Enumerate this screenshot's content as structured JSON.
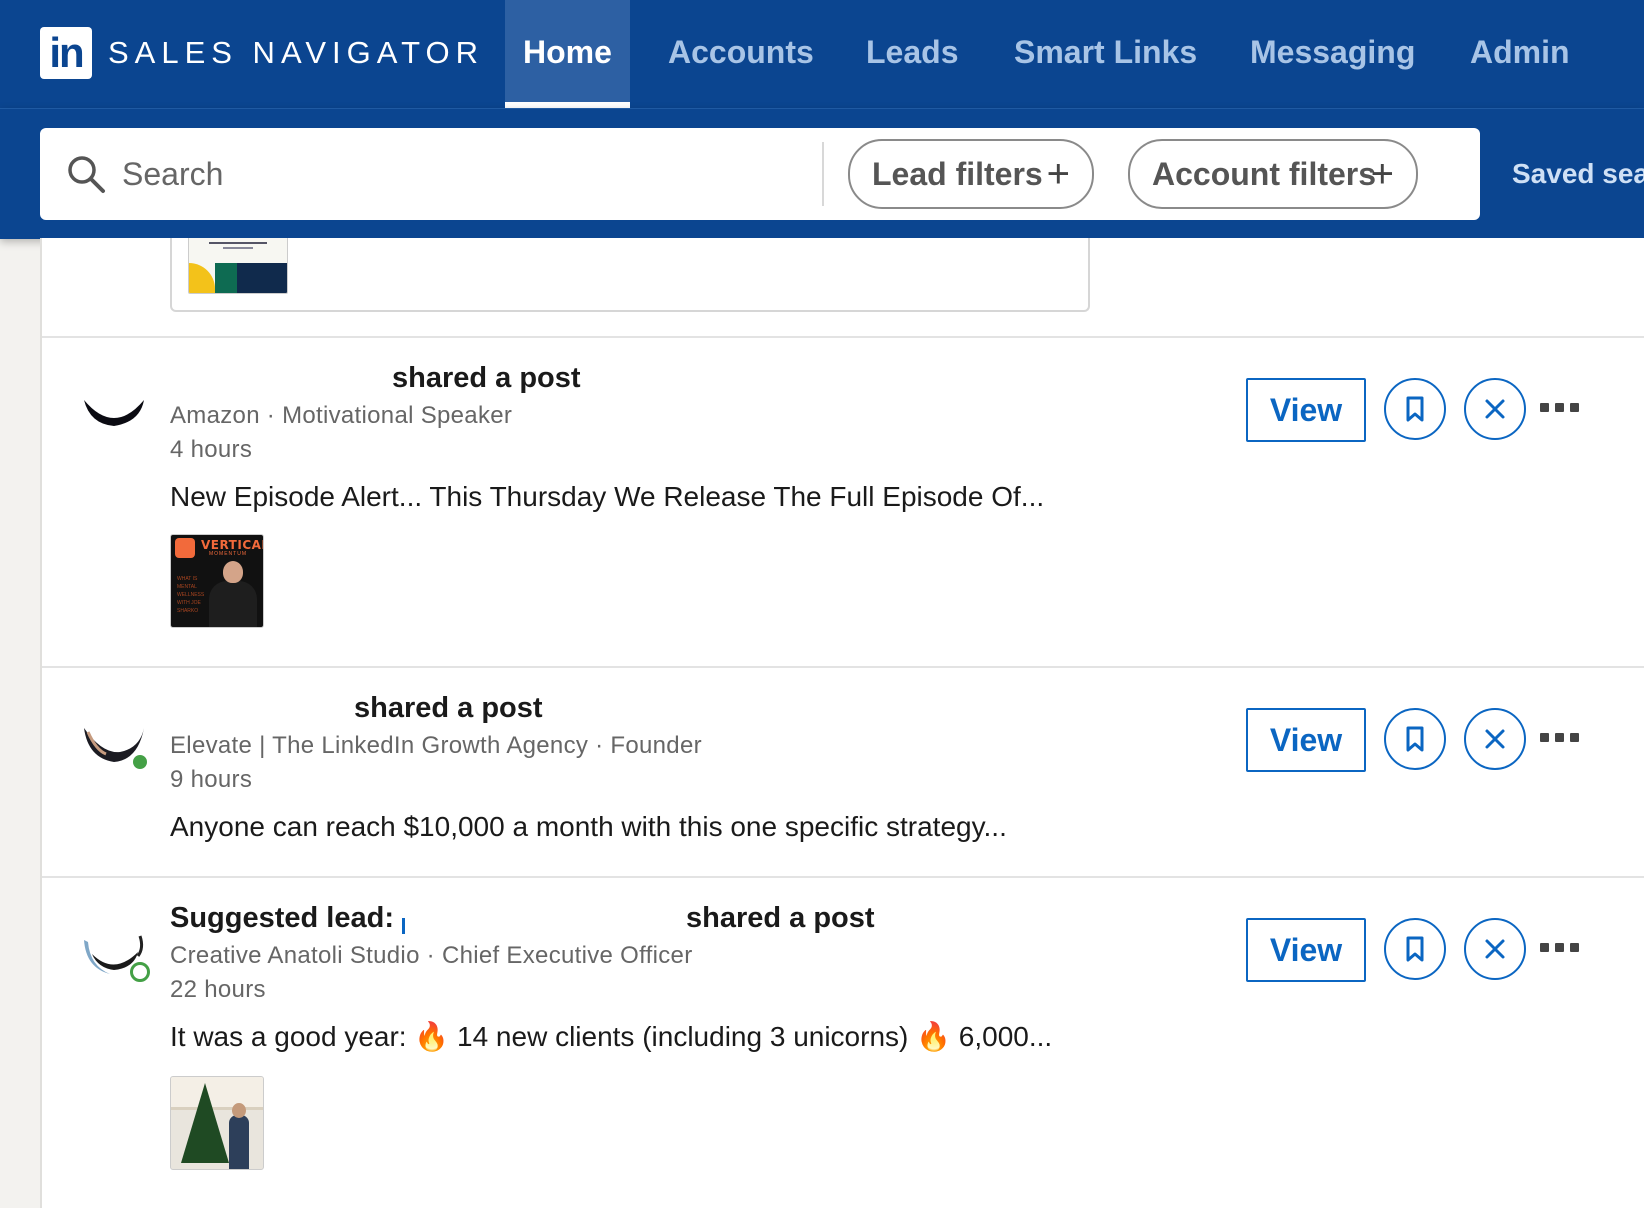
{
  "app": {
    "logo_text": "in",
    "brand": "SALES NAVIGATOR"
  },
  "nav": {
    "tabs": [
      {
        "label": "Home",
        "active": true
      },
      {
        "label": "Accounts",
        "active": false
      },
      {
        "label": "Leads",
        "active": false
      },
      {
        "label": "Smart Links",
        "active": false
      },
      {
        "label": "Messaging",
        "active": false
      },
      {
        "label": "Admin",
        "active": false
      }
    ]
  },
  "search": {
    "placeholder": "Search",
    "lead_filters_label": "Lead filters",
    "account_filters_label": "Account filters",
    "saved_searches_label": "Saved sea"
  },
  "feed": {
    "items": [
      {
        "headline": "shared a post",
        "company_role": "Amazon · Motivational Speaker",
        "time": "4 hours",
        "text": "New Episode Alert... This Thursday We Release The Full Episode Of...",
        "thumbnail": {
          "title": "VERTICAL",
          "subtitle": "MOMENTUM",
          "caption": "WHAT IS MENTAL WELLNESS WITH JOE SHARKO"
        },
        "view_label": "View",
        "online": false
      },
      {
        "headline": "shared a post",
        "company_role": "Elevate | The LinkedIn Growth Agency · Founder",
        "time": "9 hours",
        "text": "Anyone can reach $10,000 a month with this one specific strategy...",
        "view_label": "View",
        "online": true
      },
      {
        "prefix": "Suggested lead:",
        "headline": "shared a post",
        "company_role": "Creative Anatoli Studio · Chief Executive Officer",
        "time": "22 hours",
        "text": "It was a good year: 🔥 14 new clients (including 3 unicorns) 🔥 6,000...",
        "view_label": "View",
        "online": true
      }
    ]
  },
  "colors": {
    "nav_background": "#0b4590",
    "active_tab": "#2d60a3",
    "accent_blue": "#0b66c2",
    "online_green": "#44a046"
  },
  "icons": [
    "search-icon",
    "plus-icon",
    "bookmark-icon",
    "close-icon",
    "more-icon"
  ]
}
